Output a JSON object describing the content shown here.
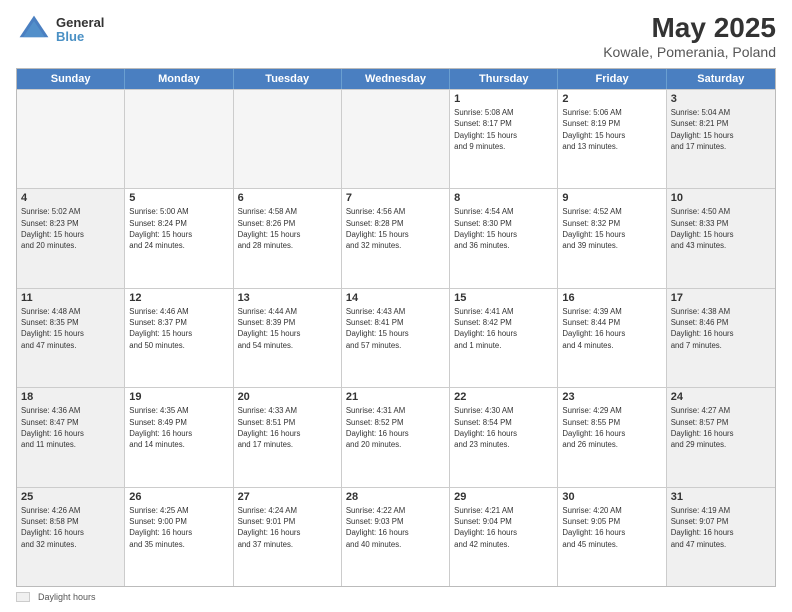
{
  "logo": {
    "line1": "General",
    "line2": "Blue"
  },
  "title": "May 2025",
  "subtitle": "Kowale, Pomerania, Poland",
  "days": [
    "Sunday",
    "Monday",
    "Tuesday",
    "Wednesday",
    "Thursday",
    "Friday",
    "Saturday"
  ],
  "legend_label": "Daylight hours",
  "weeks": [
    [
      {
        "num": "",
        "info": "",
        "empty": true
      },
      {
        "num": "",
        "info": "",
        "empty": true
      },
      {
        "num": "",
        "info": "",
        "empty": true
      },
      {
        "num": "",
        "info": "",
        "empty": true
      },
      {
        "num": "1",
        "info": "Sunrise: 5:08 AM\nSunset: 8:17 PM\nDaylight: 15 hours\nand 9 minutes.",
        "empty": false
      },
      {
        "num": "2",
        "info": "Sunrise: 5:06 AM\nSunset: 8:19 PM\nDaylight: 15 hours\nand 13 minutes.",
        "empty": false
      },
      {
        "num": "3",
        "info": "Sunrise: 5:04 AM\nSunset: 8:21 PM\nDaylight: 15 hours\nand 17 minutes.",
        "empty": false
      }
    ],
    [
      {
        "num": "4",
        "info": "Sunrise: 5:02 AM\nSunset: 8:23 PM\nDaylight: 15 hours\nand 20 minutes.",
        "empty": false
      },
      {
        "num": "5",
        "info": "Sunrise: 5:00 AM\nSunset: 8:24 PM\nDaylight: 15 hours\nand 24 minutes.",
        "empty": false
      },
      {
        "num": "6",
        "info": "Sunrise: 4:58 AM\nSunset: 8:26 PM\nDaylight: 15 hours\nand 28 minutes.",
        "empty": false
      },
      {
        "num": "7",
        "info": "Sunrise: 4:56 AM\nSunset: 8:28 PM\nDaylight: 15 hours\nand 32 minutes.",
        "empty": false
      },
      {
        "num": "8",
        "info": "Sunrise: 4:54 AM\nSunset: 8:30 PM\nDaylight: 15 hours\nand 36 minutes.",
        "empty": false
      },
      {
        "num": "9",
        "info": "Sunrise: 4:52 AM\nSunset: 8:32 PM\nDaylight: 15 hours\nand 39 minutes.",
        "empty": false
      },
      {
        "num": "10",
        "info": "Sunrise: 4:50 AM\nSunset: 8:33 PM\nDaylight: 15 hours\nand 43 minutes.",
        "empty": false
      }
    ],
    [
      {
        "num": "11",
        "info": "Sunrise: 4:48 AM\nSunset: 8:35 PM\nDaylight: 15 hours\nand 47 minutes.",
        "empty": false
      },
      {
        "num": "12",
        "info": "Sunrise: 4:46 AM\nSunset: 8:37 PM\nDaylight: 15 hours\nand 50 minutes.",
        "empty": false
      },
      {
        "num": "13",
        "info": "Sunrise: 4:44 AM\nSunset: 8:39 PM\nDaylight: 15 hours\nand 54 minutes.",
        "empty": false
      },
      {
        "num": "14",
        "info": "Sunrise: 4:43 AM\nSunset: 8:41 PM\nDaylight: 15 hours\nand 57 minutes.",
        "empty": false
      },
      {
        "num": "15",
        "info": "Sunrise: 4:41 AM\nSunset: 8:42 PM\nDaylight: 16 hours\nand 1 minute.",
        "empty": false
      },
      {
        "num": "16",
        "info": "Sunrise: 4:39 AM\nSunset: 8:44 PM\nDaylight: 16 hours\nand 4 minutes.",
        "empty": false
      },
      {
        "num": "17",
        "info": "Sunrise: 4:38 AM\nSunset: 8:46 PM\nDaylight: 16 hours\nand 7 minutes.",
        "empty": false
      }
    ],
    [
      {
        "num": "18",
        "info": "Sunrise: 4:36 AM\nSunset: 8:47 PM\nDaylight: 16 hours\nand 11 minutes.",
        "empty": false
      },
      {
        "num": "19",
        "info": "Sunrise: 4:35 AM\nSunset: 8:49 PM\nDaylight: 16 hours\nand 14 minutes.",
        "empty": false
      },
      {
        "num": "20",
        "info": "Sunrise: 4:33 AM\nSunset: 8:51 PM\nDaylight: 16 hours\nand 17 minutes.",
        "empty": false
      },
      {
        "num": "21",
        "info": "Sunrise: 4:31 AM\nSunset: 8:52 PM\nDaylight: 16 hours\nand 20 minutes.",
        "empty": false
      },
      {
        "num": "22",
        "info": "Sunrise: 4:30 AM\nSunset: 8:54 PM\nDaylight: 16 hours\nand 23 minutes.",
        "empty": false
      },
      {
        "num": "23",
        "info": "Sunrise: 4:29 AM\nSunset: 8:55 PM\nDaylight: 16 hours\nand 26 minutes.",
        "empty": false
      },
      {
        "num": "24",
        "info": "Sunrise: 4:27 AM\nSunset: 8:57 PM\nDaylight: 16 hours\nand 29 minutes.",
        "empty": false
      }
    ],
    [
      {
        "num": "25",
        "info": "Sunrise: 4:26 AM\nSunset: 8:58 PM\nDaylight: 16 hours\nand 32 minutes.",
        "empty": false
      },
      {
        "num": "26",
        "info": "Sunrise: 4:25 AM\nSunset: 9:00 PM\nDaylight: 16 hours\nand 35 minutes.",
        "empty": false
      },
      {
        "num": "27",
        "info": "Sunrise: 4:24 AM\nSunset: 9:01 PM\nDaylight: 16 hours\nand 37 minutes.",
        "empty": false
      },
      {
        "num": "28",
        "info": "Sunrise: 4:22 AM\nSunset: 9:03 PM\nDaylight: 16 hours\nand 40 minutes.",
        "empty": false
      },
      {
        "num": "29",
        "info": "Sunrise: 4:21 AM\nSunset: 9:04 PM\nDaylight: 16 hours\nand 42 minutes.",
        "empty": false
      },
      {
        "num": "30",
        "info": "Sunrise: 4:20 AM\nSunset: 9:05 PM\nDaylight: 16 hours\nand 45 minutes.",
        "empty": false
      },
      {
        "num": "31",
        "info": "Sunrise: 4:19 AM\nSunset: 9:07 PM\nDaylight: 16 hours\nand 47 minutes.",
        "empty": false
      }
    ]
  ]
}
